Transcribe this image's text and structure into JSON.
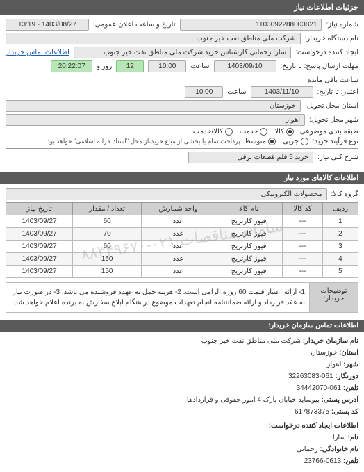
{
  "header": {
    "title": "جزئیات اطلاعات نیاز"
  },
  "form": {
    "request_no_label": "شماره نیاز:",
    "request_no": "1103092288003821",
    "announce_label": "تاریخ و ساعت اعلان عمومی:",
    "announce_value": "1403/08/27 - 13:19",
    "buyer_org_label": "نام دستگاه خریدار:",
    "buyer_org": "شرکت ملی مناطق نفت خیز جنوب",
    "requester_label": "ایجاد کننده درخواست:",
    "requester": "سارا رحمانی کارشناس خرید شرکت ملی مناطق نفت خیز جنوب",
    "contact_link": "اطلاعات تماس خریدار",
    "deadline_label": "مهلت ارسال پاسخ: تا تاریخ:",
    "deadline_date": "1403/09/10",
    "time_label": "ساعت",
    "deadline_time": "10:00",
    "days_remaining": "12",
    "days_remaining_label": "روز و",
    "countdown": "20:22:07",
    "countdown_suffix": "ساعت باقی مانده",
    "validity_label": "اعتبار: تا تاریخ:",
    "validity_date": "1403/11/10",
    "validity_time": "10:00",
    "province_label": "استان محل تحویل:",
    "province": "خوزستان",
    "city_label": "شهر محل تحویل:",
    "city": "اهواز",
    "category_label": "طبقه بندی موضوعی:",
    "radio_goods": "کالا",
    "radio_service": "خدمت",
    "radio_both": "کالا/خدمت",
    "process_label": "نوع فرآیند خرید:",
    "radio_small": "جزیی",
    "radio_medium": "متوسط",
    "process_note": "پرداخت تمام یا بخشی از مبلغ خرید،از محل \"اسناد خزانه اسلامی\" خواهد بود.",
    "subject_label": "شرح کلی نیاز:",
    "subject": "خرید 5 قلم قطعات برقی"
  },
  "goods_section": {
    "title": "اطلاعات کالاهای مورد نیاز",
    "group_label": "گروه کالا:",
    "group_value": "محصولات الکترونیکی"
  },
  "table": {
    "headers": [
      "ردیف",
      "کد کالا",
      "نام کالا",
      "واحد شمارش",
      "تعداد / مقدار",
      "تاریخ نیاز"
    ],
    "rows": [
      {
        "n": "1",
        "code": "---",
        "name": "فیوز کارتریج",
        "unit": "عدد",
        "qty": "60",
        "date": "1403/09/27"
      },
      {
        "n": "2",
        "code": "---",
        "name": "فیوز کارتریج",
        "unit": "عدد",
        "qty": "70",
        "date": "1403/09/27"
      },
      {
        "n": "3",
        "code": "---",
        "name": "فیوز کارتریج",
        "unit": "عدد",
        "qty": "60",
        "date": "1403/09/27"
      },
      {
        "n": "4",
        "code": "---",
        "name": "فیوز کارتریج",
        "unit": "عدد",
        "qty": "150",
        "date": "1403/09/27"
      },
      {
        "n": "5",
        "code": "---",
        "name": "فیوز کارتریج",
        "unit": "عدد",
        "qty": "150",
        "date": "1403/09/27"
      }
    ],
    "watermark": "سامانه مناقصات ۰۲۱-۸۸۳۴۹۶۷۰"
  },
  "desc": {
    "label": "توضیحات خریدار:",
    "content": "1- ارائه اعتبار قیمت 60 روزه الزامی است. 2- هزینه حمل به عهده فروشنده می باشد. 3- در صورت نیاز به عقد قرارداد و ارائه ضمانتنامه انجام تعهدات موضوع در هنگام ابلاغ سفارش به برنده اعلام خواهد شد."
  },
  "contact": {
    "title": "اطلاعات تماس سازمان خریدار:",
    "org_label": "نام سازمان خریدار:",
    "org": "شرکت ملی مناطق نفت خیز جنوب",
    "province_label": "استان:",
    "province": "خوزستان",
    "city_label": "شهر:",
    "city": "اهواز",
    "phone_label": "دورنگار:",
    "phone": "061-32263083",
    "fax_label": "تلفن:",
    "fax": "061-34442070",
    "address_label": "آدرس پستی:",
    "address": "بیوساید خیابان پارک 4 امور حقوقی و قراردادها",
    "postal_label": "کد پستی:",
    "postal": "617873375",
    "creator_title": "اطلاعات ایجاد کننده درخواست:",
    "name_label": "نام:",
    "name": "سارا",
    "name2_label": "نام خانوادگی:",
    "name2": "رحمانی",
    "tel_label": "تلفن:",
    "tel": "0613-23766"
  }
}
